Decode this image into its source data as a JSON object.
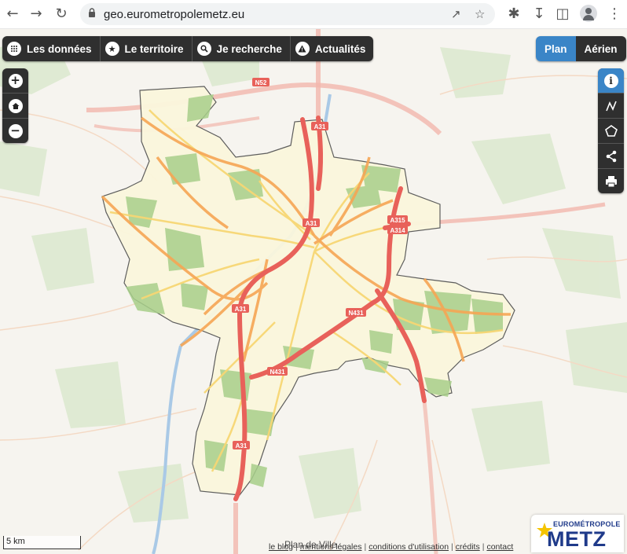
{
  "browser": {
    "url": "geo.eurometropolemetz.eu",
    "icons": [
      "back-arrow-icon",
      "forward-arrow-icon",
      "reload-icon",
      "lock-icon",
      "share-icon",
      "star-icon",
      "extension-icon",
      "download-icon",
      "sidebar-icon",
      "profile-icon",
      "kebab-menu-icon"
    ]
  },
  "toolbar": {
    "items": [
      {
        "label": "Les données",
        "icon": "grid-icon"
      },
      {
        "label": "Le territoire",
        "icon": "star-icon"
      },
      {
        "label": "Je recherche",
        "icon": "search-icon"
      },
      {
        "label": "Actualités",
        "icon": "warning-icon"
      }
    ]
  },
  "view_toggle": {
    "plan": "Plan",
    "aerien": "Aérien",
    "active": "Plan"
  },
  "zoom_controls": [
    "zoom-in-icon",
    "home-icon",
    "zoom-out-icon"
  ],
  "tools": [
    "info-icon",
    "measure-line-icon",
    "measure-area-icon",
    "share-icon",
    "print-icon"
  ],
  "map": {
    "route_labels": [
      "N52",
      "A31",
      "A31",
      "A315",
      "A314",
      "A31",
      "N431",
      "N431",
      "A31"
    ],
    "scale": "5 km",
    "plan_label": "Plan de Ville",
    "colors": {
      "highway": "#e8615a",
      "primary": "#f6a654",
      "secondary": "#fbe48a",
      "forest": "#a8cf8a",
      "boundary_fill": "#fbf7dd",
      "water": "#a9c9e6"
    }
  },
  "footer": {
    "links": [
      "le blog",
      "mentions légales",
      "conditions d'utilisation",
      "crédits",
      "contact"
    ]
  },
  "logo": {
    "top": "EUROMÉTROPOLE",
    "main": "METZ"
  }
}
